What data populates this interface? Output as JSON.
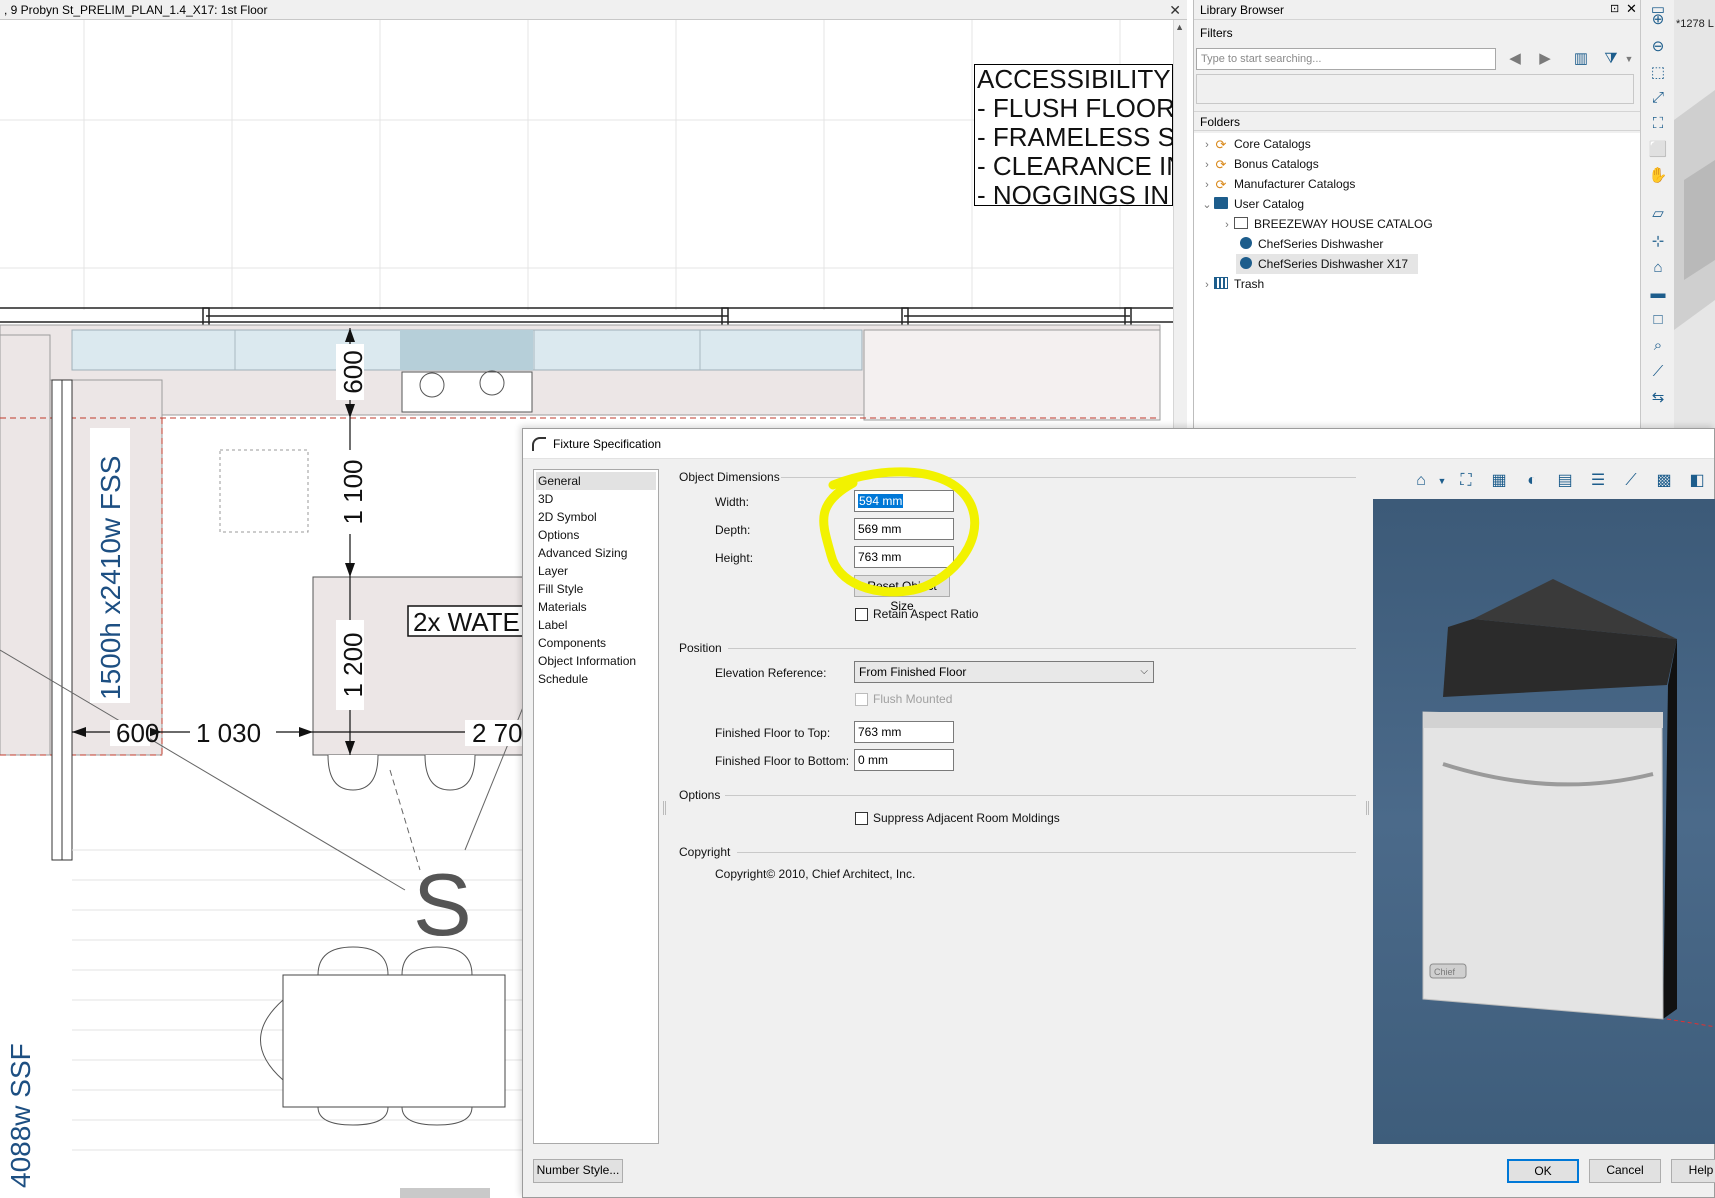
{
  "cad_window": {
    "title": ", 9 Probyn St_PRELIM_PLAN_1.4_X17: 1st Floor",
    "close": "✕",
    "note_lines": [
      "ACCESSIBILITY",
      "- FLUSH FLOOR",
      "- FRAMELESS S",
      "- CLEARANCE IN",
      "- NOGGINGS IN"
    ],
    "dimensions": {
      "d600_top": "600",
      "d1100": "1 100",
      "d1200": "1 200",
      "d600_left": "600",
      "d1030": "1 030",
      "d2700": "2 70",
      "fss_label": "1500h x2410w FSS",
      "ssf_label": "4088w SSF",
      "water_label": "2x WATE",
      "stair_s": "S"
    }
  },
  "library": {
    "title": "Library Browser",
    "pin": "⊡",
    "close": "✕",
    "filters_label": "Filters",
    "search_placeholder": "Type to start searching...",
    "folders_label": "Folders",
    "tree": [
      {
        "label": "Core Catalogs",
        "icon": "sync-catalog-icon",
        "expand": "›"
      },
      {
        "label": "Bonus Catalogs",
        "icon": "sync-catalog-icon",
        "expand": "›"
      },
      {
        "label": "Manufacturer Catalogs",
        "icon": "sync-catalog-icon",
        "expand": "›"
      },
      {
        "label": "User Catalog",
        "icon": "folder-icon",
        "expand": "⌄"
      },
      {
        "label": "BREEZEWAY HOUSE CATALOG",
        "icon": "folder-outline-icon",
        "expand": "›"
      },
      {
        "label": "ChefSeries Dishwasher",
        "icon": "object-dot-icon",
        "expand": ""
      },
      {
        "label": "ChefSeries Dishwasher X17",
        "icon": "object-dot-icon",
        "expand": ""
      },
      {
        "label": "Trash",
        "icon": "trash-icon",
        "expand": "›"
      }
    ]
  },
  "side_panel": {
    "tab_label": "*1278 L"
  },
  "dialog": {
    "title": "Fixture Specification",
    "nav": [
      "General",
      "3D",
      "2D Symbol",
      "Options",
      "Advanced Sizing",
      "Layer",
      "Fill Style",
      "Materials",
      "Label",
      "Components",
      "Object Information",
      "Schedule"
    ],
    "selected_nav": "General",
    "object_dimensions": {
      "heading": "Object Dimensions",
      "width_label": "Width:",
      "width_value": "594 mm",
      "depth_label": "Depth:",
      "depth_value": "569 mm",
      "height_label": "Height:",
      "height_value": "763 mm",
      "reset_button": "Reset Object Size",
      "retain_aspect": "Retain Aspect Ratio"
    },
    "position": {
      "heading": "Position",
      "elevation_label": "Elevation Reference:",
      "elevation_value": "From Finished Floor",
      "flush_mounted": "Flush Mounted",
      "top_label": "Finished Floor to Top:",
      "top_value": "763 mm",
      "bottom_label": "Finished Floor to Bottom:",
      "bottom_value": "0 mm"
    },
    "options": {
      "heading": "Options",
      "suppress": "Suppress Adjacent Room Moldings"
    },
    "copyright": {
      "heading": "Copyright",
      "text": "Copyright© 2010, Chief Architect, Inc."
    },
    "buttons": {
      "number_style": "Number Style...",
      "ok": "OK",
      "cancel": "Cancel",
      "help": "Help"
    },
    "preview": {
      "logo": "Chief"
    }
  },
  "colors": {
    "accent": "#0078d7",
    "catalog_blue": "#1d5d8c",
    "highlight_marker": "#f2f200",
    "preview_bg": "#3f5e7d"
  }
}
